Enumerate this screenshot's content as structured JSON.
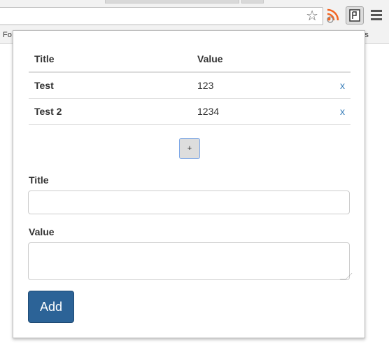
{
  "browser": {
    "bookmarks_left": "Fo",
    "bookmarks_right": "harks"
  },
  "table": {
    "headers": [
      "Title",
      "Value"
    ],
    "rows": [
      {
        "title": "Test",
        "value": "123",
        "delete": "x"
      },
      {
        "title": "Test 2",
        "value": "1234",
        "delete": "x"
      }
    ]
  },
  "add_row_button": "+",
  "form": {
    "title_label": "Title",
    "value_label": "Value",
    "title_value": "",
    "value_value": "",
    "submit_label": "Add"
  },
  "colors": {
    "primary_button": "#2c6397",
    "link": "#337ab7",
    "rss_orange": "#f26522"
  },
  "icons": [
    "star-icon",
    "rss-icon",
    "extension-icon",
    "menu-icon"
  ]
}
